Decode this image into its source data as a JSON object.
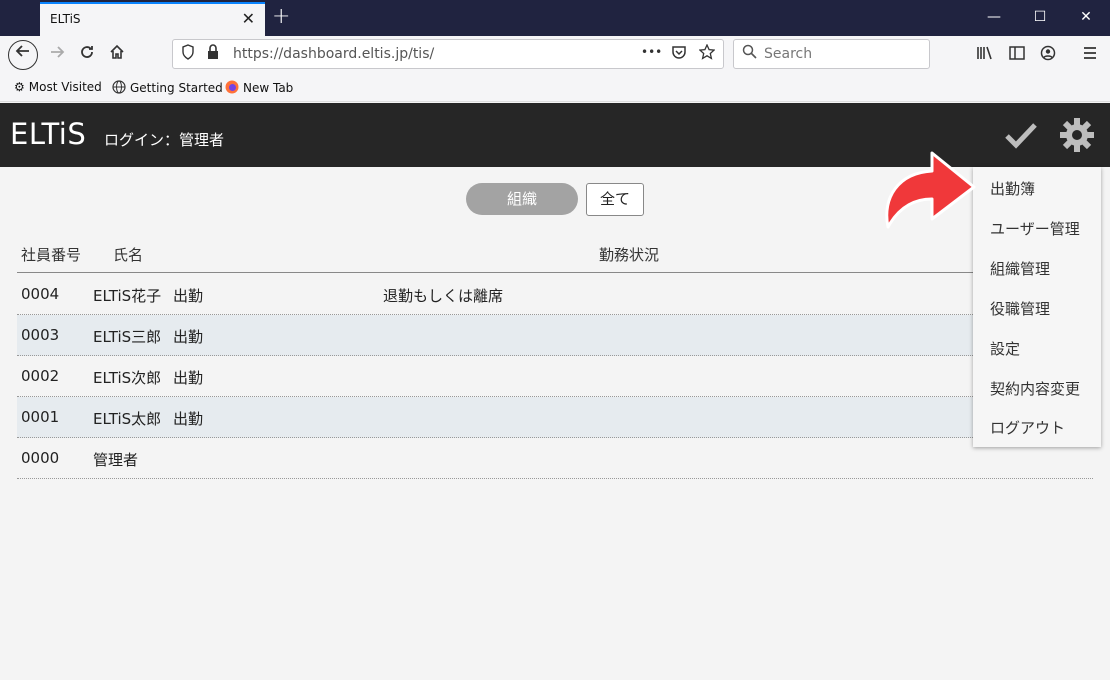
{
  "browser": {
    "tab_title": "ELTiS",
    "tab_close": "✕",
    "new_tab": "+",
    "url": "https://dashboard.eltis.jp/tis/",
    "url_dots": "•••",
    "search_placeholder": "Search",
    "bookmarks": [
      {
        "label": "Most Visited"
      },
      {
        "label": "Getting Started"
      },
      {
        "label": "New Tab"
      }
    ]
  },
  "header": {
    "logo": "ELTiS",
    "login": "ログイン：管理者"
  },
  "filters": {
    "org_label": "組織",
    "all_label": "全て"
  },
  "table": {
    "columns": [
      "社員番号",
      "氏名",
      "勤務状況"
    ],
    "rows": [
      {
        "id": "0004",
        "name": "ELTiS花子",
        "status": "出勤",
        "note": "退勤もしくは離席"
      },
      {
        "id": "0003",
        "name": "ELTiS三郎",
        "status": "出勤",
        "note": ""
      },
      {
        "id": "0002",
        "name": "ELTiS次郎",
        "status": "出勤",
        "note": ""
      },
      {
        "id": "0001",
        "name": "ELTiS太郎",
        "status": "出勤",
        "note": ""
      },
      {
        "id": "0000",
        "name": "管理者",
        "status": "",
        "note": ""
      }
    ]
  },
  "menu": {
    "items": [
      "出勤簿",
      "ユーザー管理",
      "組織管理",
      "役職管理",
      "設定",
      "契約内容変更",
      "ログアウト"
    ]
  },
  "colors": {
    "header_bg": "#262626",
    "arrow": "#f0383a",
    "row_alt": "#e6ebef"
  }
}
